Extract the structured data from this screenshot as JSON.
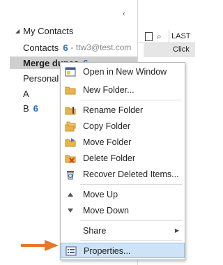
{
  "nav": {
    "header": "My Contacts",
    "items": [
      {
        "label": "Contacts",
        "count": "6",
        "sub": "- ttw3@test.com"
      },
      {
        "label": "Merge dupes",
        "count": "6",
        "sub": ""
      },
      {
        "label": "Personal C",
        "count": "",
        "sub": ""
      },
      {
        "label": "A",
        "count": "",
        "sub": ""
      },
      {
        "label": "B",
        "count": "6",
        "sub": ""
      }
    ]
  },
  "list": {
    "column_last": "LAST",
    "row_text": "Click"
  },
  "menu": {
    "items": [
      {
        "label": "Open in New Window",
        "icon": "new-window-icon"
      },
      {
        "label": "New Folder...",
        "icon": "folder-icon"
      },
      {
        "label": "Rename Folder",
        "icon": "rename-folder-icon"
      },
      {
        "label": "Copy Folder",
        "icon": "copy-folder-icon"
      },
      {
        "label": "Move Folder",
        "icon": "move-folder-icon"
      },
      {
        "label": "Delete Folder",
        "icon": "delete-folder-icon"
      },
      {
        "label": "Recover Deleted Items...",
        "icon": "recycle-bin-icon"
      },
      {
        "label": "Move Up",
        "icon": "up-triangle-icon"
      },
      {
        "label": "Move Down",
        "icon": "down-triangle-icon"
      },
      {
        "label": "Share",
        "icon": ""
      },
      {
        "label": "Properties...",
        "icon": "properties-icon"
      }
    ]
  },
  "colors": {
    "accent_blue": "#1f6fc5",
    "highlight": "#cde3f7",
    "arrow_orange": "#e8762a"
  }
}
